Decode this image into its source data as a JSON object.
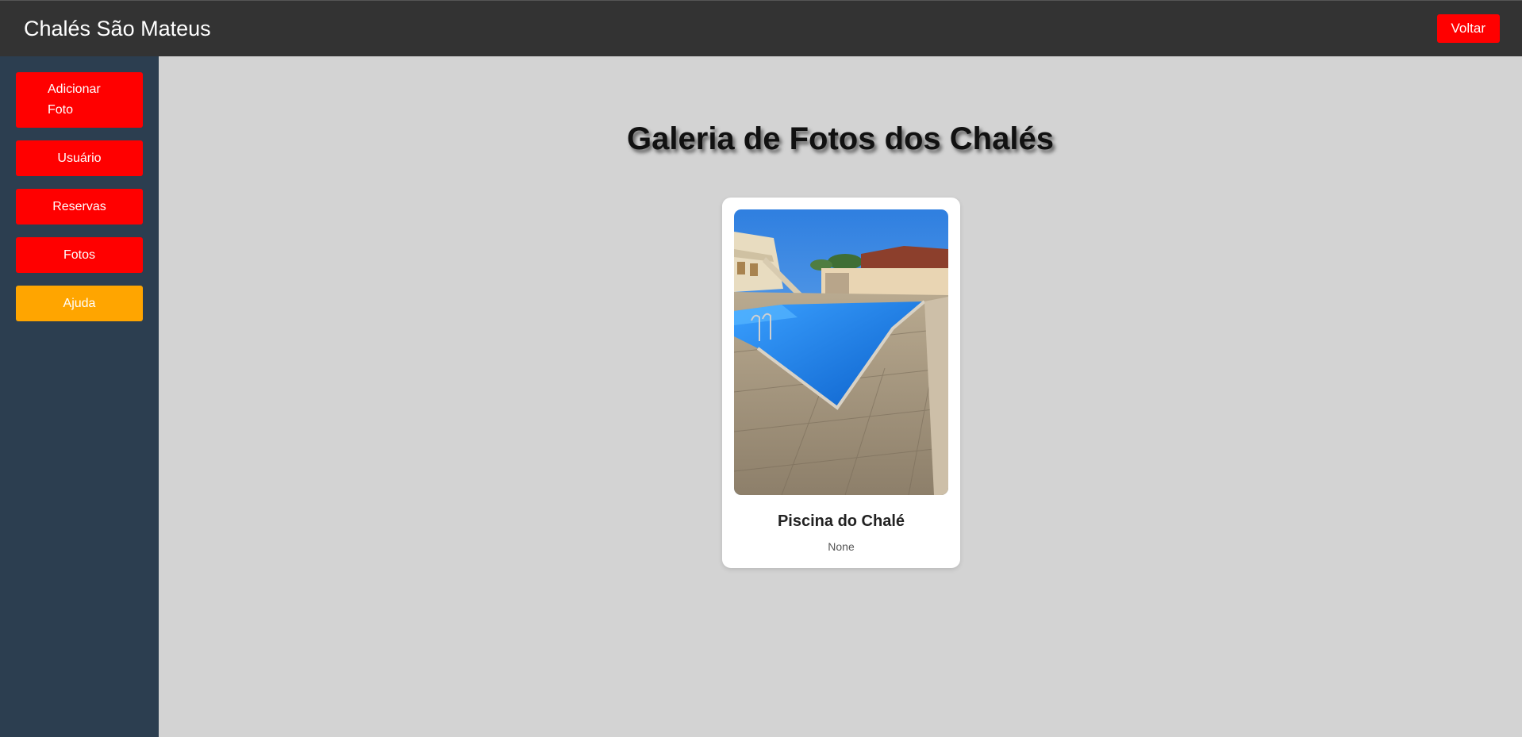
{
  "header": {
    "brand": "Chalés São Mateus",
    "back_label": "Voltar"
  },
  "sidebar": {
    "items": [
      {
        "label": "Adicionar Foto"
      },
      {
        "label": "Usuário"
      },
      {
        "label": "Reservas"
      },
      {
        "label": "Fotos"
      },
      {
        "label": "Ajuda"
      }
    ]
  },
  "main": {
    "title": "Galeria de Fotos dos Chalés",
    "photos": [
      {
        "title": "Piscina do Chalé",
        "description": "None"
      }
    ]
  },
  "colors": {
    "topbar": "#333333",
    "sidebar": "#2c3e50",
    "primary_button": "#ff0000",
    "help_button": "#ffa500",
    "page_background": "#d3d3d3"
  }
}
